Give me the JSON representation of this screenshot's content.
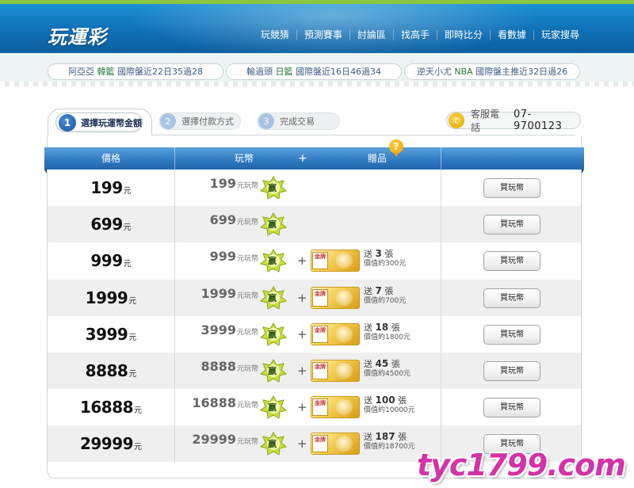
{
  "header": {
    "logo": "玩運彩",
    "nav": [
      "玩競猜",
      "預測賽事",
      "討論區",
      "找高手",
      "即時比分",
      "看數據",
      "玩家搜尋"
    ]
  },
  "news": [
    {
      "prefix": "阿亞亞",
      "league": "韓籃",
      "text": "國際盤近22日35過28"
    },
    {
      "prefix": "輸過頭",
      "league": "日籃",
      "text": "國際盤近16日46過34"
    },
    {
      "prefix": "逆天小尤",
      "league": "NBA",
      "text": "國際盤主推近32日過26"
    }
  ],
  "steps": [
    {
      "num": "1",
      "label": "選擇玩運幣金額"
    },
    {
      "num": "2",
      "label": "選擇付款方式"
    },
    {
      "num": "3",
      "label": "完成交易"
    }
  ],
  "service": {
    "label": "客服電話",
    "number": "07-9700123"
  },
  "table": {
    "headers": {
      "price": "價格",
      "coins": "玩幣",
      "plus": "+",
      "gift": "贈品"
    },
    "help_icon": "?",
    "currency_unit": "元",
    "coin_unit": "元玩幣",
    "coin_badge": "嬴",
    "gift_badge": "金牌",
    "gift_prefix": "送",
    "gift_suffix": "張",
    "gift_value_prefix": "價值約",
    "gift_value_suffix": "元",
    "buy_label": "買玩幣",
    "rows": [
      {
        "price": "199",
        "coins": "199",
        "gift": null
      },
      {
        "price": "699",
        "coins": "699",
        "gift": null
      },
      {
        "price": "999",
        "coins": "999",
        "gift": {
          "count": "3",
          "value": "300"
        }
      },
      {
        "price": "1999",
        "coins": "1999",
        "gift": {
          "count": "7",
          "value": "700"
        }
      },
      {
        "price": "3999",
        "coins": "3999",
        "gift": {
          "count": "18",
          "value": "1800"
        }
      },
      {
        "price": "8888",
        "coins": "8888",
        "gift": {
          "count": "45",
          "value": "4500"
        }
      },
      {
        "price": "16888",
        "coins": "16888",
        "gift": {
          "count": "100",
          "value": "10000"
        }
      },
      {
        "price": "29999",
        "coins": "29999",
        "gift": {
          "count": "187",
          "value": "18700"
        }
      }
    ]
  },
  "watermark": "tyc1799.com",
  "colors": {
    "header_blue": "#0f6fb5",
    "accent_green": "#8bc63e",
    "table_header_blue": "#2e78c0",
    "watermark": "#d432a8"
  }
}
